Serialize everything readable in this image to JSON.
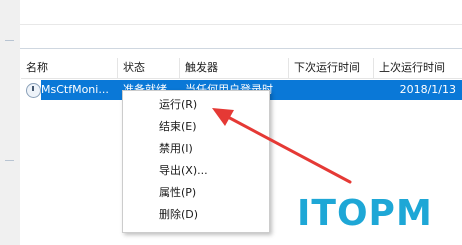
{
  "table": {
    "columns": [
      "名称",
      "状态",
      "触发器",
      "下次运行时间",
      "上次运行时间"
    ],
    "selected_row": {
      "name": "MsCtfMoni...",
      "status": "准备就绪",
      "trigger": "当任何用户登录时",
      "last_run": "2018/1/13"
    }
  },
  "context_menu": {
    "items": [
      "运行(R)",
      "结束(E)",
      "禁用(I)",
      "导出(X)...",
      "属性(P)",
      "删除(D)"
    ],
    "highlighted_index": 0
  },
  "annotation": {
    "arrow_color": "#e53935"
  },
  "watermark": {
    "text": "ITOPM",
    "color": "#1ea7d6"
  },
  "colors": {
    "selection": "#0a78d7"
  }
}
